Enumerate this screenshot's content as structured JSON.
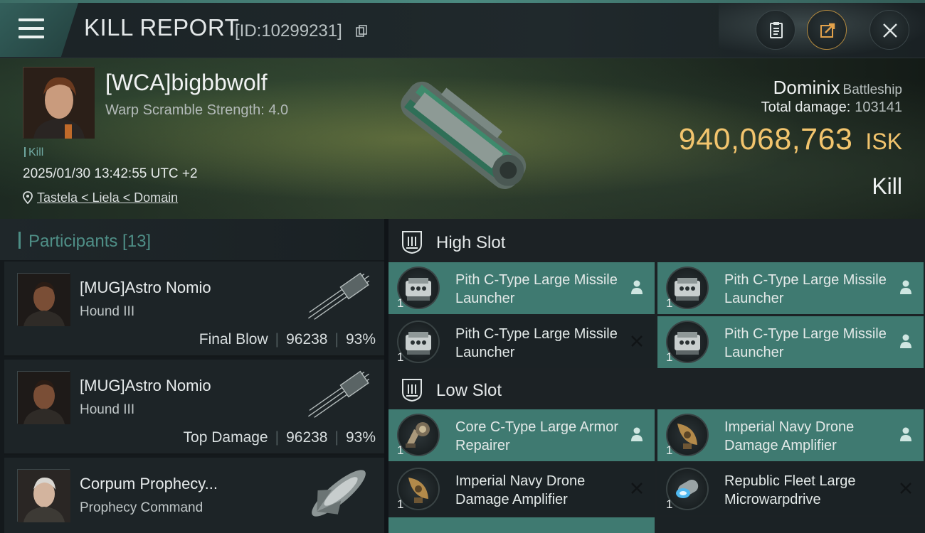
{
  "header": {
    "title": "KILL REPORT",
    "report_id": "[ID:10299231]"
  },
  "victim": {
    "name": "[WCA]bigbbwolf",
    "warp_scramble": "Warp Scramble Strength: 4.0",
    "kill_tag": "Kill",
    "datetime": "2025/01/30 13:42:55 UTC +2",
    "location": "Tastela < Liela < Domain",
    "ship_name": "Dominix",
    "ship_class": "Battleship",
    "total_damage_label": "Total damage:",
    "total_damage": "103141",
    "isk_value": "940,068,763",
    "isk_unit": "ISK",
    "result": "Kill"
  },
  "participants": {
    "label": "Participants [13]",
    "items": [
      {
        "name": "[MUG]Astro Nomio",
        "ship": "Hound III",
        "role": "Final Blow",
        "damage": "96238",
        "percent": "93%"
      },
      {
        "name": "[MUG]Astro Nomio",
        "ship": "Hound III",
        "role": "Top Damage",
        "damage": "96238",
        "percent": "93%"
      },
      {
        "name": "Corpum Prophecy...",
        "ship": "Prophecy Command",
        "role": "",
        "damage": "",
        "percent": ""
      }
    ]
  },
  "slots": {
    "high": {
      "label": "High Slot",
      "modules": [
        {
          "name": "Pith C-Type Large Missile Launcher",
          "qty": "1",
          "status": "owned",
          "icon": "missile-launcher-icon"
        },
        {
          "name": "Pith C-Type Large Missile Launcher",
          "qty": "1",
          "status": "owned",
          "icon": "missile-launcher-icon"
        },
        {
          "name": "Pith C-Type Large Missile Launcher",
          "qty": "1",
          "status": "destroyed",
          "icon": "missile-launcher-icon"
        },
        {
          "name": "Pith C-Type Large Missile Launcher",
          "qty": "1",
          "status": "owned",
          "icon": "missile-launcher-icon"
        }
      ]
    },
    "low": {
      "label": "Low Slot",
      "modules": [
        {
          "name": "Core C-Type Large Armor Repairer",
          "qty": "1",
          "status": "owned",
          "icon": "armor-repairer-icon"
        },
        {
          "name": "Imperial Navy Drone Damage Amplifier",
          "qty": "1",
          "status": "owned",
          "icon": "drone-amplifier-icon"
        },
        {
          "name": "Imperial Navy Drone Damage Amplifier",
          "qty": "1",
          "status": "destroyed",
          "icon": "drone-amplifier-icon"
        },
        {
          "name": "Republic Fleet Large Microwarpdrive",
          "qty": "1",
          "status": "destroyed",
          "icon": "microwarpdrive-icon"
        }
      ]
    }
  },
  "colors": {
    "accent_teal": "#3f7a71",
    "isk_gold": "#f2c46d"
  }
}
